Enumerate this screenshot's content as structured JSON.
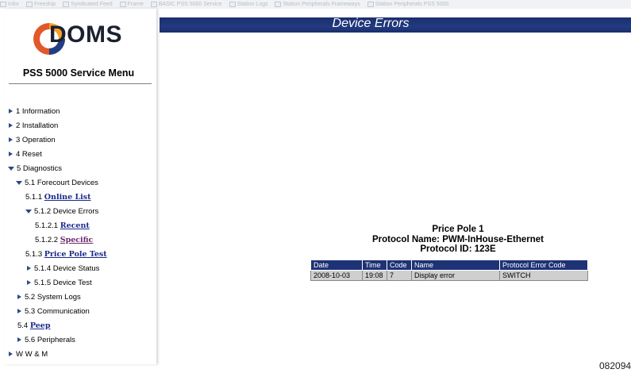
{
  "bookmarks": [
    "Infor",
    "Freeship",
    "Syndicated Feed",
    "Frame",
    "BASIC PSS 5000 Service",
    "Station Logs",
    "Station Peripherals Frameways",
    "Station Peripherals PSS 5000"
  ],
  "brand": {
    "name": "DOMS"
  },
  "sidebar": {
    "menu_title": "PSS 5000 Service Menu",
    "items": [
      {
        "text": "1 Information"
      },
      {
        "text": "2 Installation"
      },
      {
        "text": "3 Operation"
      },
      {
        "text": "4 Reset"
      },
      {
        "text": "5 Diagnostics"
      },
      {
        "text": "5.1 Forecourt Devices"
      },
      {
        "prefix": "5.1.1",
        "link": "Online List"
      },
      {
        "text": "5.1.2 Device Errors"
      },
      {
        "prefix": "5.1.2.1",
        "link": "Recent"
      },
      {
        "prefix": "5.1.2.2",
        "link": "Specific"
      },
      {
        "prefix": "5.1.3",
        "link": "Price Pole Test"
      },
      {
        "text": "5.1.4 Device Status"
      },
      {
        "text": "5.1.5 Device Test"
      },
      {
        "text": "5.2 System Logs"
      },
      {
        "text": "5.3 Communication"
      },
      {
        "prefix": "5.4",
        "link": "Peep"
      },
      {
        "text": "5.6 Peripherals"
      },
      {
        "text": "W W & M"
      }
    ]
  },
  "header": {
    "title": "Device Errors"
  },
  "device": {
    "name": "Price Pole 1",
    "protocol_name": "Protocol Name: PWM-InHouse-Ethernet",
    "protocol_id": "Protocol ID: 123E"
  },
  "errors_table": {
    "columns": [
      "Date",
      "Time",
      "Code",
      "Name",
      "Protocol Error Code"
    ],
    "rows": [
      [
        "2008-10-03",
        "19:08",
        "7",
        "Display error",
        "SWITCH"
      ]
    ]
  },
  "doc_number": "082094",
  "colors": {
    "header": "#1e3276",
    "accent": "#2a4a86",
    "link": "#1b2a8c",
    "visited_link": "#6b2a6e"
  }
}
